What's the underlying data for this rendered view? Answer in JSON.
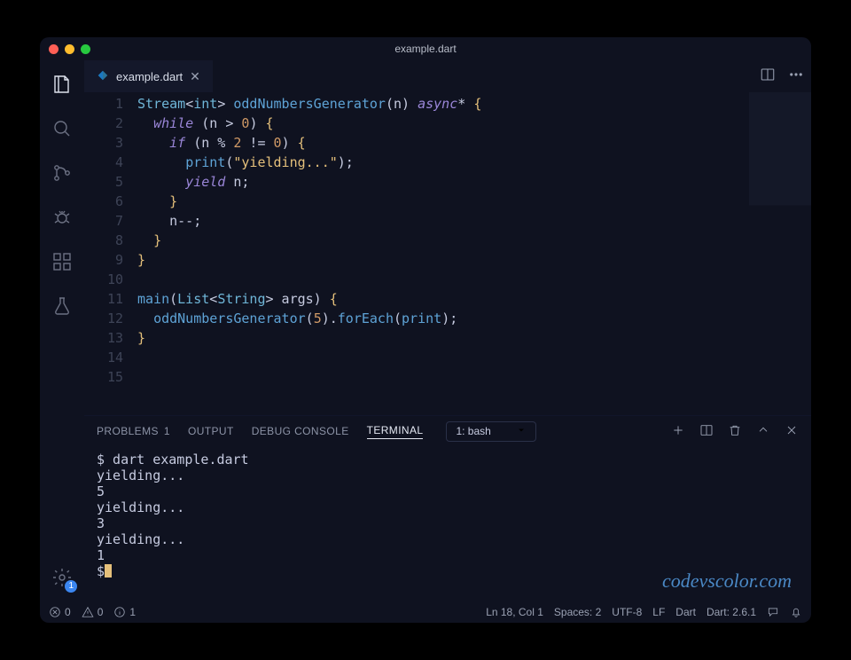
{
  "titlebar": {
    "title": "example.dart"
  },
  "tab": {
    "filename": "example.dart"
  },
  "gear_badge": "1",
  "code_lines": [
    "Stream<int> oddNumbersGenerator(n) async* {",
    "  while (n > 0) {",
    "    if (n % 2 != 0) {",
    "      print(\"yielding...\");",
    "      yield n;",
    "    }",
    "    n--;",
    "  }",
    "}",
    "",
    "main(List<String> args) {",
    "  oddNumbersGenerator(5).forEach(print);",
    "}",
    "",
    ""
  ],
  "panel": {
    "tabs": {
      "problems": "PROBLEMS",
      "problems_count": "1",
      "output": "OUTPUT",
      "debug": "DEBUG CONSOLE",
      "terminal": "TERMINAL"
    },
    "shell": "1: bash"
  },
  "terminal_lines": [
    "$ dart example.dart",
    "yielding...",
    "5",
    "yielding...",
    "3",
    "yielding...",
    "1",
    "$ "
  ],
  "watermark": "codevscolor.com",
  "status": {
    "errors": "0",
    "warnings": "0",
    "info": "1",
    "position": "Ln 18, Col 1",
    "spaces": "Spaces: 2",
    "encoding": "UTF-8",
    "eol": "LF",
    "lang": "Dart",
    "sdk": "Dart: 2.6.1"
  }
}
